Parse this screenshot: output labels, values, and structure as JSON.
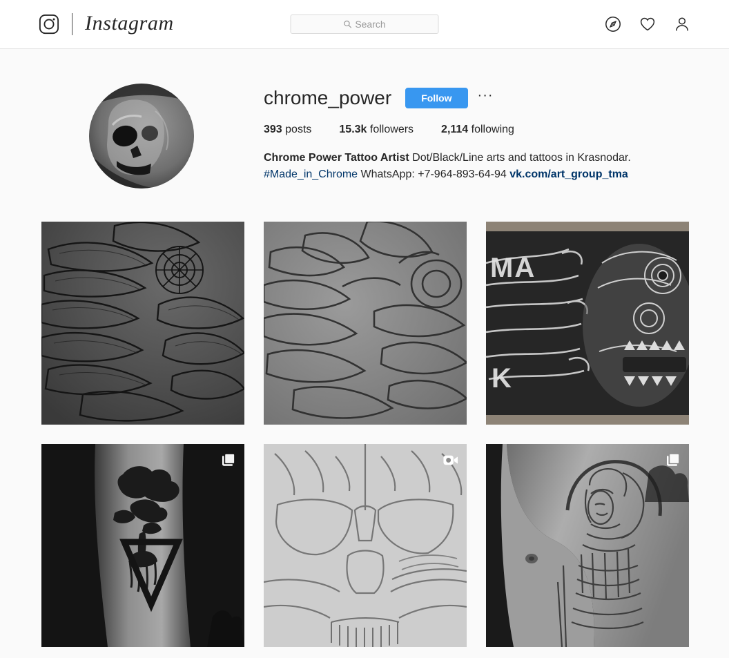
{
  "nav": {
    "logo_icon": "instagram-camera-icon",
    "wordmark": "Instagram",
    "search": {
      "placeholder": "Search",
      "value": "",
      "icon": "search-icon"
    },
    "icons": [
      {
        "name": "explore-compass-icon",
        "label": "Explore"
      },
      {
        "name": "activity-heart-icon",
        "label": "Activity"
      },
      {
        "name": "profile-person-icon",
        "label": "Profile"
      }
    ]
  },
  "profile": {
    "avatar_alt": "skull artwork profile photo",
    "username": "chrome_power",
    "follow_label": "Follow",
    "options_label": "···",
    "stats": [
      {
        "value": "393",
        "label": "posts"
      },
      {
        "value": "15.3k",
        "label": "followers"
      },
      {
        "value": "2,114",
        "label": "following"
      }
    ],
    "bio": {
      "full_name": "Chrome Power Tattoo Artist",
      "description": " Dot/Black/Line arts and tattoos in Krasnodar.",
      "hashtag": "#Made_in_Chrome",
      "contact": " WhatsApp: +7-964-893-64-94 ",
      "link": "vk.com/art_group_tma"
    }
  },
  "colors": {
    "accent_blue": "#3897f0",
    "link_blue": "#003569",
    "text": "#262626",
    "page_bg": "#fafafa",
    "border": "#dbdbdb"
  },
  "grid": {
    "posts": [
      {
        "id": "post-1",
        "alt": "chrysanthemum line art drawing dark",
        "badge": null
      },
      {
        "id": "post-2",
        "alt": "chrysanthemum outline sketch light",
        "badge": null
      },
      {
        "id": "post-3",
        "alt": "chalkboard flaming skull drawing",
        "badge": null
      },
      {
        "id": "post-4",
        "alt": "forearm bonsai tree triangle tattoo",
        "badge": "carousel-icon"
      },
      {
        "id": "post-5",
        "alt": "pencil skull sketch on paper",
        "badge": "video-icon"
      },
      {
        "id": "post-6",
        "alt": "shoulder warrior athena tattoo",
        "badge": "carousel-icon"
      }
    ]
  }
}
